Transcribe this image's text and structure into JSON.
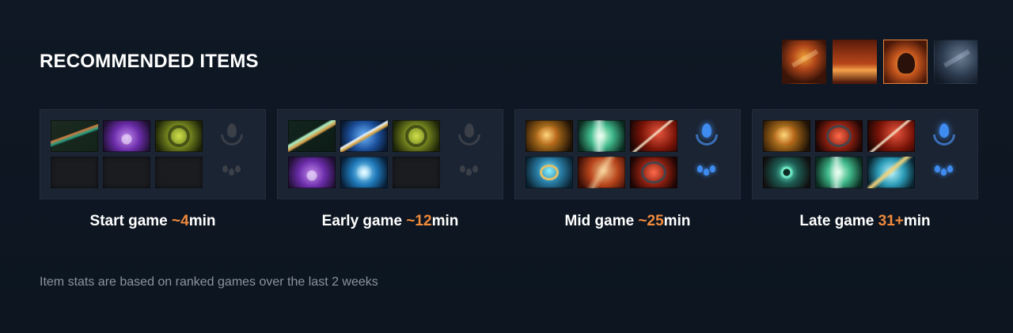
{
  "title": "RECOMMENDED ITEMS",
  "abilities": [
    {
      "icon": "fire-phoenix-ability-icon",
      "selected": false
    },
    {
      "icon": "fire-pillar-ability-icon",
      "selected": false
    },
    {
      "icon": "hero-portrait-ability-icon",
      "selected": true
    },
    {
      "icon": "starfall-ability-icon",
      "selected": false
    }
  ],
  "stages": [
    {
      "label_prefix": "Start game ",
      "label_time": "~4",
      "label_suffix": "min",
      "items": [
        "staff-item-icon",
        "magic-pouch-item-icon",
        "golden-ring-item-icon",
        "empty",
        "empty",
        "empty"
      ],
      "neutral_active": false
    },
    {
      "label_prefix": "Early game ",
      "label_time": "~12",
      "label_suffix": "min",
      "items": [
        "wand-item-icon",
        "magic-pouch-item-icon",
        "golden-ring-item-icon",
        "magic-pouch-item-icon",
        "energy-orb-item-icon",
        "empty"
      ],
      "items_order": [
        "wand-item-icon",
        "blue-sword-item-icon",
        "golden-ring-item-icon",
        "magic-pouch-item-icon",
        "energy-orb-item-icon",
        "empty"
      ],
      "neutral_active": false
    },
    {
      "label_prefix": "Mid game ",
      "label_time": "~25",
      "label_suffix": "min",
      "items_order": [
        "golden-helm-item-icon",
        "glowing-scroll-item-icon",
        "red-scythe-item-icon",
        "frost-amulet-item-icon",
        "fire-cape-item-icon",
        "dragon-claw-item-icon"
      ],
      "neutral_active": true
    },
    {
      "label_prefix": "Late game ",
      "label_time": "31+",
      "label_suffix": "min",
      "items_order": [
        "golden-helm-item-icon",
        "dragon-claw-item-icon",
        "red-scythe-item-icon",
        "stone-eye-item-icon",
        "glowing-scroll-item-icon",
        "blue-bird-item-icon"
      ],
      "neutral_active": true
    }
  ],
  "footnote": "Item stats are based on ranked games over the last 2 weeks",
  "colors": {
    "background": "#0e1622",
    "panel": "#1b2432",
    "accent_orange": "#f08a3c",
    "neutral_blue": "#3f8cf0",
    "muted_text": "#8a939f"
  }
}
